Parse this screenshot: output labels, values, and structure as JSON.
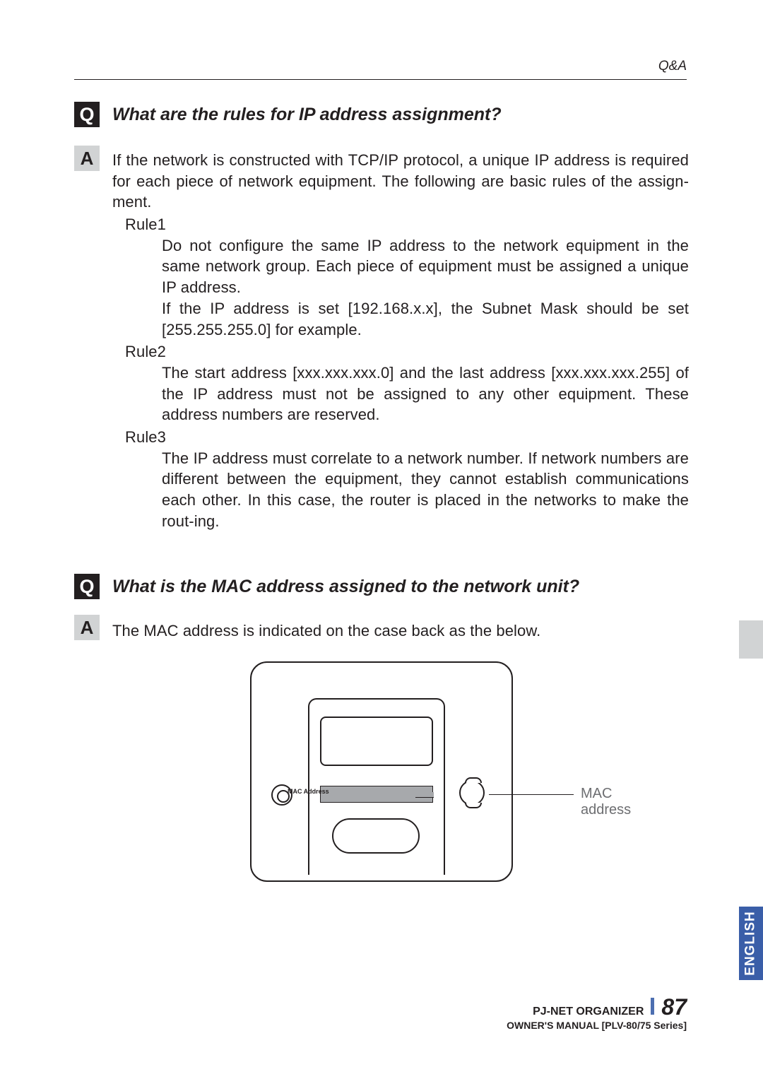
{
  "header": "Q&A",
  "qa": [
    {
      "q_label": "Q",
      "a_label": "A",
      "question": "What are the rules for IP address assignment?",
      "answer_intro": "If the network is constructed with TCP/IP protocol, a unique IP address is required for each piece of network equipment. The following are basic rules of the assign-ment.",
      "rules": [
        {
          "label": "Rule1",
          "body": "Do not configure the same IP address to the network equipment in the same network group. Each piece of equipment must be assigned a unique IP address.\nIf the IP address is set [192.168.x.x], the Subnet Mask should be set [255.255.255.0] for example."
        },
        {
          "label": "Rule2",
          "body": "The start address [xxx.xxx.xxx.0] and the last address [xxx.xxx.xxx.255] of the IP address must not be assigned to any other equipment. These address numbers are reserved."
        },
        {
          "label": "Rule3",
          "body": "The IP address must correlate to a network number. If network numbers are different between the equipment, they cannot establish communications each other. In this case, the router is placed in the networks to make the rout-ing."
        }
      ]
    },
    {
      "q_label": "Q",
      "a_label": "A",
      "question": "What is the MAC address assigned to the network unit?",
      "answer_intro": "The MAC address is indicated on the case back as the below."
    }
  ],
  "figure": {
    "mac_label_inside": "MAC Address",
    "callout": "MAC address"
  },
  "side_tab": "ENGLISH",
  "footer": {
    "product": "PJ-NET ORGANIZER",
    "page": "87",
    "manual": "OWNER'S MANUAL [PLV-80/75 Series]"
  }
}
